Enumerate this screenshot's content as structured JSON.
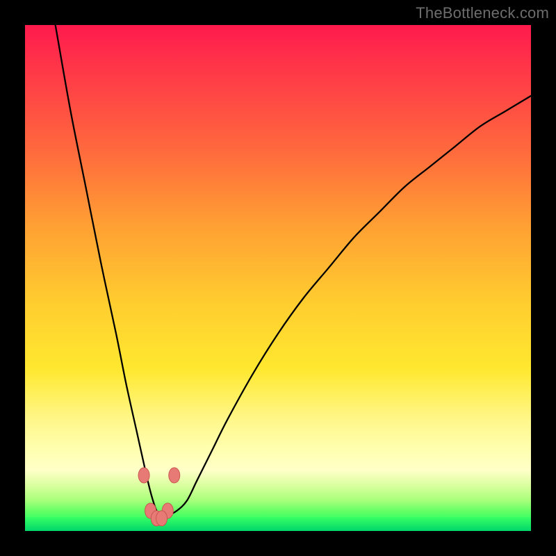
{
  "watermark": "TheBottleneck.com",
  "colors": {
    "frame": "#000000",
    "gradient_top": "#ff1a4d",
    "gradient_bottom": "#00e56b",
    "curve": "#000000",
    "marker_fill": "#e77a74",
    "marker_stroke": "#c95751"
  },
  "chart_data": {
    "type": "line",
    "title": "",
    "xlabel": "",
    "ylabel": "",
    "xlim": [
      0,
      100
    ],
    "ylim": [
      0,
      100
    ],
    "series": [
      {
        "name": "bottleneck-curve",
        "x": [
          6,
          9,
          12,
          15,
          18,
          20,
          22,
          24,
          25,
          26,
          27,
          28,
          30,
          32,
          34,
          37,
          40,
          45,
          50,
          55,
          60,
          65,
          70,
          75,
          80,
          85,
          90,
          95,
          100
        ],
        "y": [
          100,
          83,
          68,
          53,
          39,
          29,
          20,
          11,
          7,
          4,
          3,
          3,
          4,
          6,
          10,
          16,
          22,
          31,
          39,
          46,
          52,
          58,
          63,
          68,
          72,
          76,
          80,
          83,
          86
        ]
      }
    ],
    "markers": [
      {
        "x": 23.5,
        "y": 11
      },
      {
        "x": 29.5,
        "y": 11
      },
      {
        "x": 24.8,
        "y": 4
      },
      {
        "x": 28.2,
        "y": 4
      },
      {
        "x": 26.0,
        "y": 2.5
      },
      {
        "x": 27.0,
        "y": 2.5
      }
    ],
    "annotations": [
      {
        "text": "TheBottleneck.com",
        "pos": "top-right"
      }
    ]
  }
}
